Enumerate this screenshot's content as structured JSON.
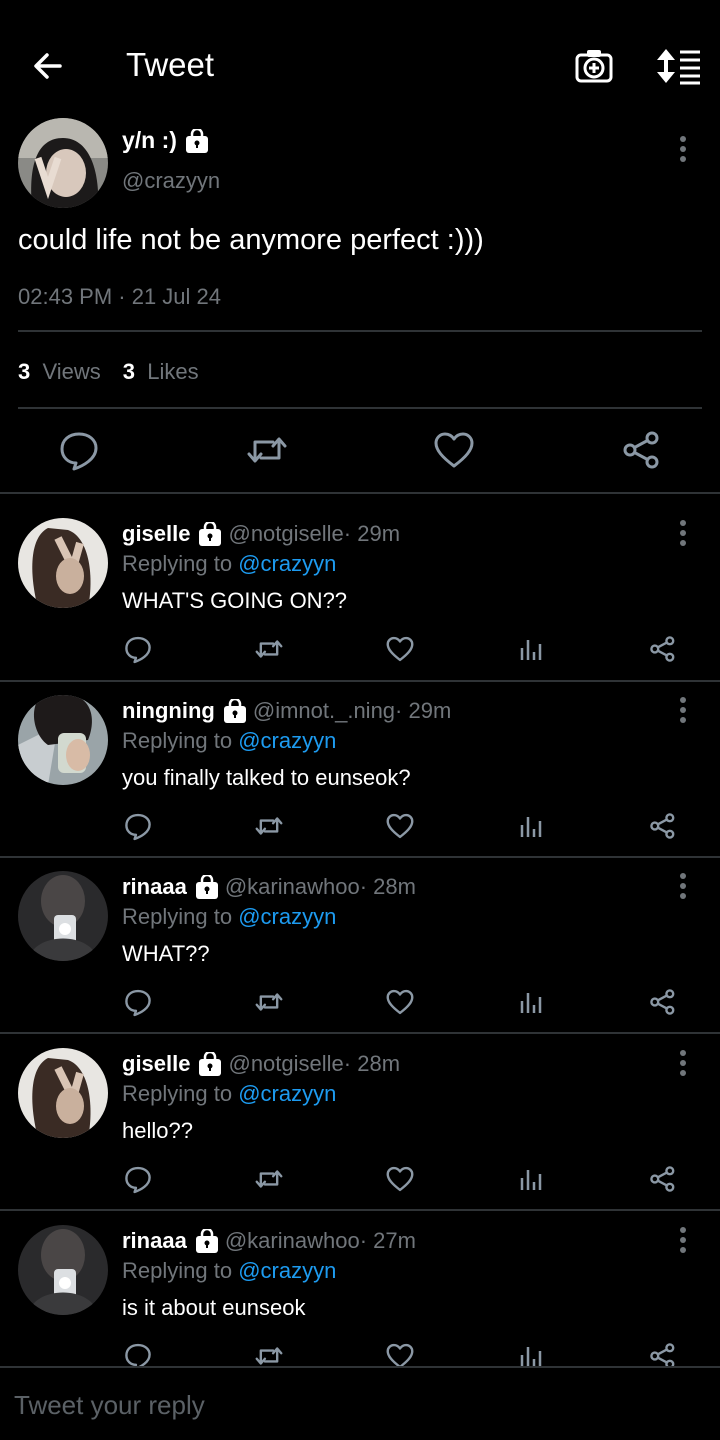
{
  "header": {
    "title": "Tweet",
    "back_icon": "arrow-left-icon",
    "camera_icon": "camera-add-icon",
    "sort_icon": "sort-list-icon"
  },
  "main_tweet": {
    "name": "y/n :)",
    "handle": "@crazyyn",
    "text": "could life not be anymore perfect :)))",
    "timestamp": "02:43 PM · 21 Jul 24",
    "views_count": "3",
    "views_label": "Views",
    "likes_count": "3",
    "likes_label": "Likes",
    "actions": [
      "reply-icon",
      "retweet-icon",
      "like-icon",
      "share-icon"
    ]
  },
  "replies": [
    {
      "name": "giselle",
      "handle": "@notgiselle",
      "time": " · 29m",
      "replying_label": "Replying to ",
      "replying_to": "@crazyyn",
      "text": "WHAT'S GOING ON??"
    },
    {
      "name": "ningning",
      "handle": "@imnot._.ning",
      "time": " · 29m",
      "replying_label": "Replying to ",
      "replying_to": "@crazyyn",
      "text": "you finally talked to eunseok?"
    },
    {
      "name": "rinaaa",
      "handle": "@karinawhoo",
      "time": " · 28m",
      "replying_label": "Replying to ",
      "replying_to": "@crazyyn",
      "text": "WHAT??"
    },
    {
      "name": "giselle",
      "handle": "@notgiselle",
      "time": " · 28m",
      "replying_label": "Replying to ",
      "replying_to": "@crazyyn",
      "text": "hello??"
    },
    {
      "name": "rinaaa",
      "handle": "@karinawhoo",
      "time": " · 27m",
      "replying_label": "Replying to ",
      "replying_to": "@crazyyn",
      "text": "is it about eunseok"
    }
  ],
  "composer": {
    "placeholder": "Tweet your reply"
  },
  "colors": {
    "background": "#000000",
    "text": "#ffffff",
    "secondary": "#71767b",
    "accent": "#1d9bf0",
    "divider": "#2f3336"
  }
}
